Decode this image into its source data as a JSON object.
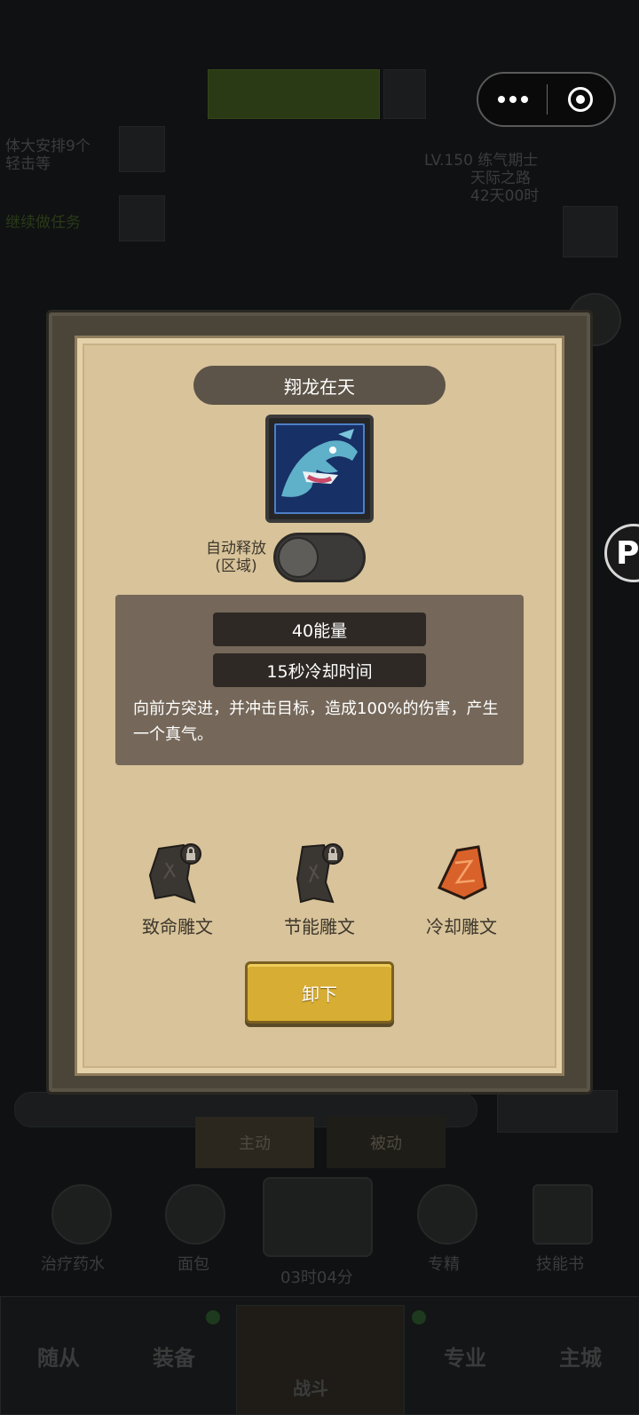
{
  "modal": {
    "title": "翔龙在天",
    "auto_release_label": "自动释放",
    "auto_release_sub": "(区域)",
    "auto_release_on": false,
    "energy": "40能量",
    "cooldown": "15秒冷却时间",
    "description": "向前方突进，并冲击目标，造成100%的伤害，产生一个真气。",
    "runes": [
      {
        "name": "致命雕文",
        "locked": true,
        "icon": "lock-icon"
      },
      {
        "name": "节能雕文",
        "locked": true,
        "icon": "lock-icon"
      },
      {
        "name": "冷却雕文",
        "locked": false,
        "icon": "cooldown-rune-icon"
      }
    ],
    "unequip_label": "卸下"
  },
  "background": {
    "left_tasks": [
      "体大安排9个",
      "轻击等",
      "继续做任务"
    ],
    "right_info": [
      "LV.150 练气期士",
      "天际之路",
      "42天00时"
    ],
    "tabs": [
      "主动",
      "被动"
    ],
    "items": [
      "治疗药水",
      "面包",
      "03时04分",
      "专精",
      "技能书"
    ],
    "nav": [
      "随从",
      "装备",
      "战斗",
      "专业",
      "主城"
    ]
  },
  "colors": {
    "accent": "#d8ad33",
    "paper": "#d8c39a",
    "panel": "#75685a"
  }
}
